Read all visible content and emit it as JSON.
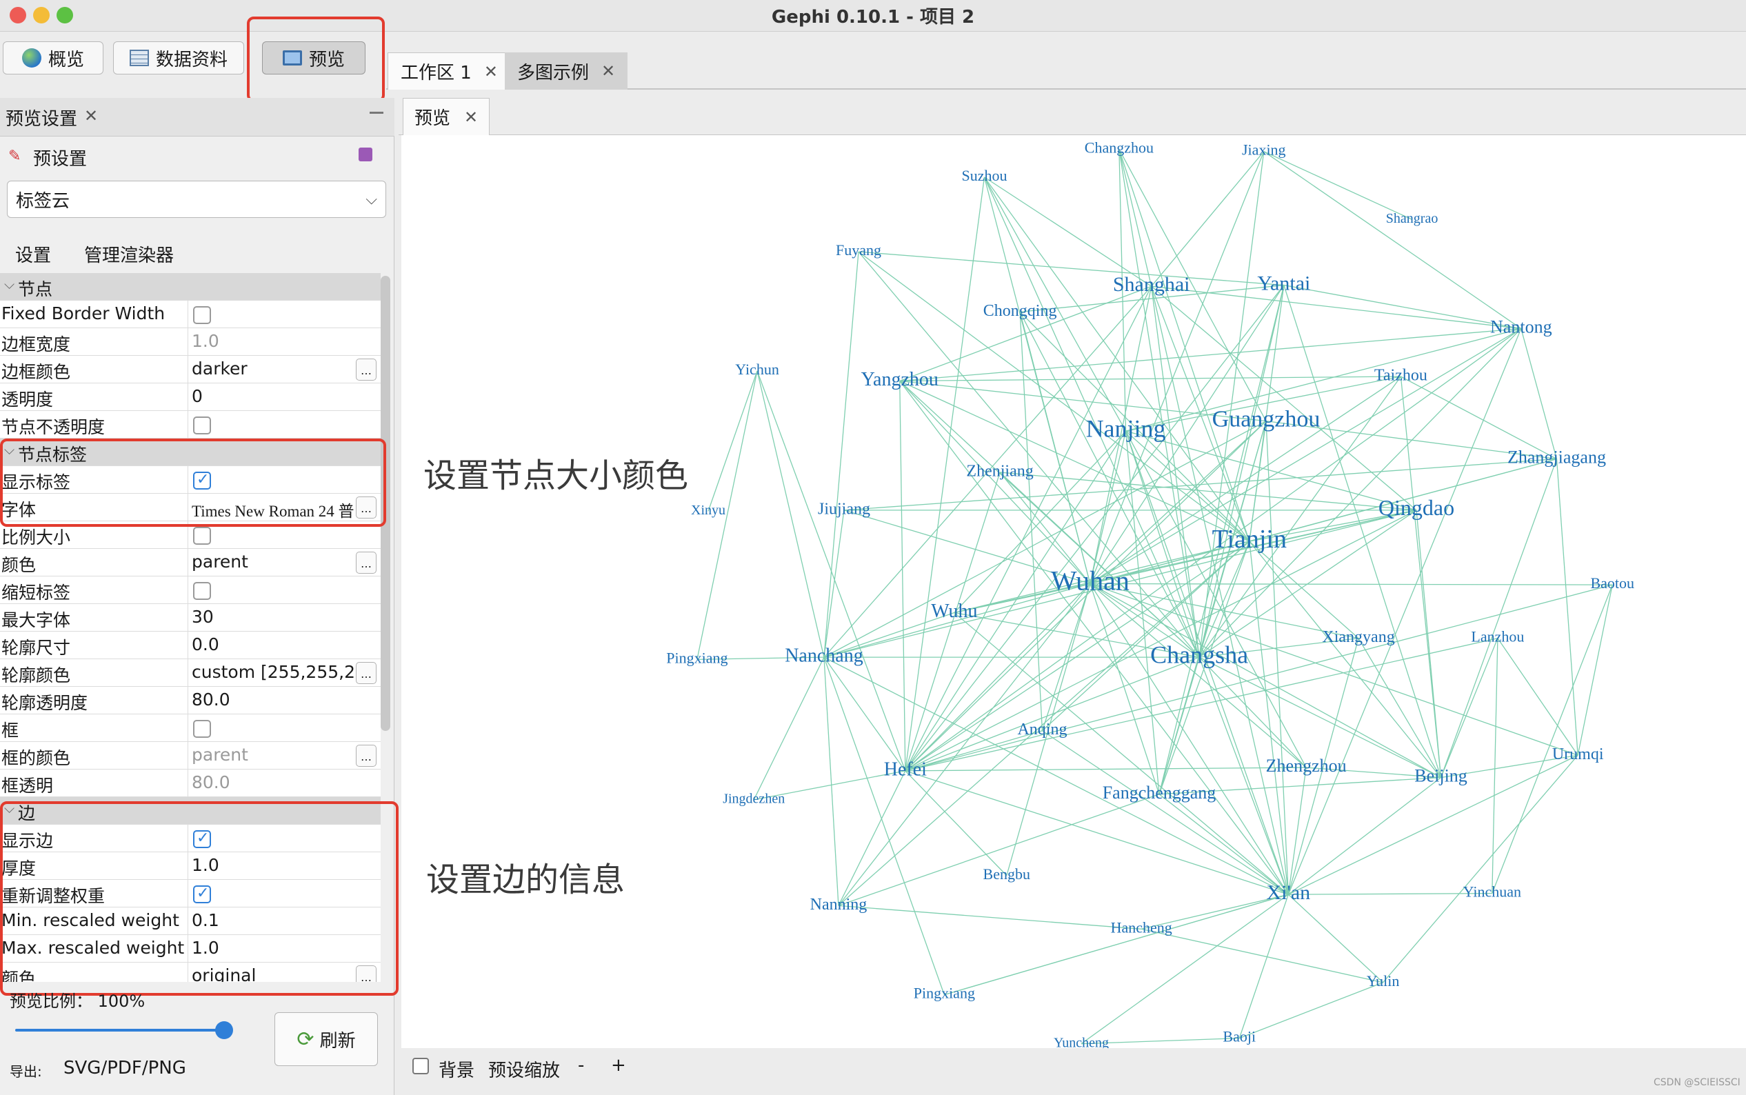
{
  "window": {
    "title": "Gephi 0.10.1 - 项目 2"
  },
  "modes": [
    {
      "label": "概览",
      "icon": "globe-icon"
    },
    {
      "label": "数据资料",
      "icon": "table-icon"
    },
    {
      "label": "预览",
      "icon": "monitor-icon",
      "active": true
    }
  ],
  "workspace_tabs": [
    {
      "label": "工作区 1",
      "active": true
    },
    {
      "label": "多图示例",
      "active": false
    }
  ],
  "left": {
    "panel_title": "预览设置",
    "preset_label": "预设置",
    "preset_value": "标签云",
    "subtabs": [
      "设置",
      "管理渲染器"
    ],
    "properties": [
      {
        "type": "group",
        "name": "节点"
      },
      {
        "name": "Fixed Border Width",
        "kind": "checkbox",
        "checked": false
      },
      {
        "name": "边框宽度",
        "kind": "text",
        "value": "1.0",
        "disabled": true
      },
      {
        "name": "边框颜色",
        "kind": "text",
        "value": "darker",
        "dots": true
      },
      {
        "name": "透明度",
        "kind": "text",
        "value": "0"
      },
      {
        "name": "节点不透明度",
        "kind": "checkbox",
        "checked": false
      },
      {
        "type": "group",
        "name": "节点标签"
      },
      {
        "name": "显示标签",
        "kind": "checkbox",
        "checked": true
      },
      {
        "name": "字体",
        "kind": "font",
        "value": "Times New Roman 24 普",
        "dots": true
      },
      {
        "name": "比例大小",
        "kind": "checkbox",
        "checked": false
      },
      {
        "name": "颜色",
        "kind": "text",
        "value": "parent",
        "dots": true
      },
      {
        "name": "缩短标签",
        "kind": "checkbox",
        "checked": false
      },
      {
        "name": "最大字体",
        "kind": "text",
        "value": "30"
      },
      {
        "name": "轮廓尺寸",
        "kind": "text",
        "value": "0.0"
      },
      {
        "name": "轮廓颜色",
        "kind": "text",
        "value": "custom [255,255,2...",
        "dots": true
      },
      {
        "name": "轮廓透明度",
        "kind": "text",
        "value": "80.0"
      },
      {
        "name": "框",
        "kind": "checkbox",
        "checked": false
      },
      {
        "name": "框的颜色",
        "kind": "text",
        "value": "parent",
        "disabled": true,
        "dots": true
      },
      {
        "name": "框透明",
        "kind": "text",
        "value": "80.0",
        "disabled": true
      },
      {
        "type": "group",
        "name": "边"
      },
      {
        "name": "显示边",
        "kind": "checkbox",
        "checked": true
      },
      {
        "name": "厚度",
        "kind": "text",
        "value": "1.0"
      },
      {
        "name": "重新调整权重",
        "kind": "checkbox",
        "checked": true
      },
      {
        "name": "Min. rescaled weight",
        "kind": "text",
        "value": "0.1"
      },
      {
        "name": "Max. rescaled weight",
        "kind": "text",
        "value": "1.0"
      },
      {
        "name": "颜色",
        "kind": "text",
        "value": "original",
        "dots": true
      }
    ],
    "zoom_label": "预览比例： 100%",
    "zoom_value": 1.0,
    "refresh_label": "刷新",
    "export_label": "导出:",
    "export_value": "SVG/PDF/PNG"
  },
  "preview": {
    "tab_label": "预览",
    "annotation_nodes": "设置节点大小颜色",
    "annotation_edges": "设置边的信息",
    "bottom": {
      "background_label": "背景",
      "zoom_label": "预设缩放",
      "minus": "-",
      "plus": "+"
    },
    "edge_color": "#7fcfb0",
    "label_color": "#1f6fb5",
    "watermark": "CSDN @SCIEISSCI"
  },
  "graph": {
    "nodes": [
      {
        "id": "Changzhou",
        "label": "Changzhou",
        "size": 22
      },
      {
        "id": "Jiaxing",
        "label": "Jiaxing",
        "size": 22
      },
      {
        "id": "Suzhou",
        "label": "Suzhou",
        "size": 22
      },
      {
        "id": "Shangrao",
        "label": "Shangrao",
        "size": 20
      },
      {
        "id": "Fuyang",
        "label": "Fuyang",
        "size": 22
      },
      {
        "id": "Shanghai",
        "label": "Shanghai",
        "size": 30
      },
      {
        "id": "Yantai",
        "label": "Yantai",
        "size": 30
      },
      {
        "id": "Chongqing",
        "label": "Chongqing",
        "size": 24
      },
      {
        "id": "Nantong",
        "label": "Nantong",
        "size": 26
      },
      {
        "id": "Yichun",
        "label": "Yichun",
        "size": 22
      },
      {
        "id": "Yangzhou",
        "label": "Yangzhou",
        "size": 28
      },
      {
        "id": "Taizhou",
        "label": "Taizhou",
        "size": 24
      },
      {
        "id": "Nanjing",
        "label": "Nanjing",
        "size": 36
      },
      {
        "id": "Guangzhou",
        "label": "Guangzhou",
        "size": 34
      },
      {
        "id": "Zhangjiagang",
        "label": "Zhangjiagang",
        "size": 26
      },
      {
        "id": "Zhenjiang",
        "label": "Zhenjiang",
        "size": 24
      },
      {
        "id": "Xinyu",
        "label": "Xinyu",
        "size": 20
      },
      {
        "id": "Jiujiang",
        "label": "Jiujiang",
        "size": 24
      },
      {
        "id": "Qingdao",
        "label": "Qingdao",
        "size": 32
      },
      {
        "id": "Tianjin",
        "label": "Tianjin",
        "size": 38
      },
      {
        "id": "Baotou",
        "label": "Baotou",
        "size": 22
      },
      {
        "id": "Wuhan",
        "label": "Wuhan",
        "size": 40
      },
      {
        "id": "Wuhu",
        "label": "Wuhu",
        "size": 28
      },
      {
        "id": "Changsha",
        "label": "Changsha",
        "size": 36
      },
      {
        "id": "Xiangyang",
        "label": "Xiangyang",
        "size": 24
      },
      {
        "id": "Lanzhou",
        "label": "Lanzhou",
        "size": 22
      },
      {
        "id": "Pingxiang1",
        "label": "Pingxiang",
        "size": 22
      },
      {
        "id": "Nanchang",
        "label": "Nanchang",
        "size": 28
      },
      {
        "id": "Anqing",
        "label": "Anqing",
        "size": 24
      },
      {
        "id": "Urumqi",
        "label": "Urumqi",
        "size": 24
      },
      {
        "id": "Hefei",
        "label": "Hefei",
        "size": 28
      },
      {
        "id": "Zhengzhou",
        "label": "Zhengzhou",
        "size": 26
      },
      {
        "id": "Beijing",
        "label": "Beijing",
        "size": 26
      },
      {
        "id": "Jingdezhen",
        "label": "Jingdezhen",
        "size": 20
      },
      {
        "id": "Fangchenggang",
        "label": "Fangchenggang",
        "size": 26
      },
      {
        "id": "Bengbu",
        "label": "Bengbu",
        "size": 22
      },
      {
        "id": "Xian",
        "label": "Xi'an",
        "size": 30
      },
      {
        "id": "Yinchuan",
        "label": "Yinchuan",
        "size": 22
      },
      {
        "id": "Nanning",
        "label": "Nanning",
        "size": 24
      },
      {
        "id": "Hancheng",
        "label": "Hancheng",
        "size": 22
      },
      {
        "id": "Pingxiang2",
        "label": "Pingxiang",
        "size": 22
      },
      {
        "id": "Yulin",
        "label": "Yulin",
        "size": 22
      },
      {
        "id": "Yuncheng",
        "label": "Yuncheng",
        "size": 20
      },
      {
        "id": "Baoji",
        "label": "Baoji",
        "size": 22
      }
    ],
    "edges": [
      [
        "Suzhou",
        "Shanghai"
      ],
      [
        "Suzhou",
        "Nanjing"
      ],
      [
        "Suzhou",
        "Tianjin"
      ],
      [
        "Suzhou",
        "Wuhan"
      ],
      [
        "Suzhou",
        "Hefei"
      ],
      [
        "Suzhou",
        "Changsha"
      ],
      [
        "Changzhou",
        "Shanghai"
      ],
      [
        "Changzhou",
        "Nanjing"
      ],
      [
        "Changzhou",
        "Tianjin"
      ],
      [
        "Changzhou",
        "Changsha"
      ],
      [
        "Changzhou",
        "Guangzhou"
      ],
      [
        "Jiaxing",
        "Shanghai"
      ],
      [
        "Jiaxing",
        "Nantong"
      ],
      [
        "Jiaxing",
        "Shangrao"
      ],
      [
        "Jiaxing",
        "Wuhan"
      ],
      [
        "Jiaxing",
        "Changsha"
      ],
      [
        "Fuyang",
        "Yantai"
      ],
      [
        "Fuyang",
        "Nanchang"
      ],
      [
        "Fuyang",
        "Tianjin"
      ],
      [
        "Fuyang",
        "Changsha"
      ],
      [
        "Shanghai",
        "Wuhan"
      ],
      [
        "Shanghai",
        "Tianjin"
      ],
      [
        "Shanghai",
        "Changsha"
      ],
      [
        "Shanghai",
        "Qingdao"
      ],
      [
        "Shanghai",
        "Hefei"
      ],
      [
        "Shanghai",
        "Nanchang"
      ],
      [
        "Shanghai",
        "Xian"
      ],
      [
        "Shanghai",
        "Nantong"
      ],
      [
        "Shanghai",
        "Yangzhou"
      ],
      [
        "Yantai",
        "Wuhan"
      ],
      [
        "Yantai",
        "Tianjin"
      ],
      [
        "Yantai",
        "Changsha"
      ],
      [
        "Yantai",
        "Nantong"
      ],
      [
        "Yantai",
        "Beijing"
      ],
      [
        "Yantai",
        "Hefei"
      ],
      [
        "Yantai",
        "Chongqing"
      ],
      [
        "Yantai",
        "Fangchenggang"
      ],
      [
        "Chongqing",
        "Wuhan"
      ],
      [
        "Chongqing",
        "Tianjin"
      ],
      [
        "Chongqing",
        "Changsha"
      ],
      [
        "Chongqing",
        "Anqing"
      ],
      [
        "Nantong",
        "Wuhan"
      ],
      [
        "Nantong",
        "Changsha"
      ],
      [
        "Nantong",
        "Zhangjiagang"
      ],
      [
        "Nantong",
        "Xian"
      ],
      [
        "Nantong",
        "Yangzhou"
      ],
      [
        "Nantong",
        "Hefei"
      ],
      [
        "Nantong",
        "Nanjing"
      ],
      [
        "Yichun",
        "Xinyu"
      ],
      [
        "Yichun",
        "Nanchang"
      ],
      [
        "Yichun",
        "Pingxiang1"
      ],
      [
        "Yichun",
        "Hefei"
      ],
      [
        "Yangzhou",
        "Wuhan"
      ],
      [
        "Yangzhou",
        "Tianjin"
      ],
      [
        "Yangzhou",
        "Guangzhou"
      ],
      [
        "Yangzhou",
        "Hefei"
      ],
      [
        "Yangzhou",
        "Xian"
      ],
      [
        "Yangzhou",
        "Changsha"
      ],
      [
        "Yangzhou",
        "Taizhou"
      ],
      [
        "Taizhou",
        "Wuhan"
      ],
      [
        "Taizhou",
        "Changsha"
      ],
      [
        "Taizhou",
        "Zhangjiagang"
      ],
      [
        "Taizhou",
        "Nanjing"
      ],
      [
        "Taizhou",
        "Beijing"
      ],
      [
        "Nanjing",
        "Wuhan"
      ],
      [
        "Nanjing",
        "Tianjin"
      ],
      [
        "Nanjing",
        "Changsha"
      ],
      [
        "Nanjing",
        "Hefei"
      ],
      [
        "Nanjing",
        "Qingdao"
      ],
      [
        "Nanjing",
        "Xian"
      ],
      [
        "Nanjing",
        "Fangchenggang"
      ],
      [
        "Nanjing",
        "Wuhu"
      ],
      [
        "Nanjing",
        "Zhengzhou"
      ],
      [
        "Guangzhou",
        "Wuhan"
      ],
      [
        "Guangzhou",
        "Tianjin"
      ],
      [
        "Guangzhou",
        "Changsha"
      ],
      [
        "Guangzhou",
        "Zhangjiagang"
      ],
      [
        "Guangzhou",
        "Hefei"
      ],
      [
        "Guangzhou",
        "Fangchenggang"
      ],
      [
        "Guangzhou",
        "Nanchang"
      ],
      [
        "Guangzhou",
        "Xian"
      ],
      [
        "Zhangjiagang",
        "Wuhan"
      ],
      [
        "Zhangjiagang",
        "Tianjin"
      ],
      [
        "Zhangjiagang",
        "Beijing"
      ],
      [
        "Zhangjiagang",
        "Urumqi"
      ],
      [
        "Zhangjiagang",
        "Jiujiang"
      ],
      [
        "Zhenjiang",
        "Wuhan"
      ],
      [
        "Zhenjiang",
        "Qingdao"
      ],
      [
        "Zhenjiang",
        "Changsha"
      ],
      [
        "Zhenjiang",
        "Hefei"
      ],
      [
        "Jiujiang",
        "Wuhan"
      ],
      [
        "Jiujiang",
        "Qingdao"
      ],
      [
        "Jiujiang",
        "Nanchang"
      ],
      [
        "Qingdao",
        "Wuhan"
      ],
      [
        "Qingdao",
        "Tianjin"
      ],
      [
        "Qingdao",
        "Changsha"
      ],
      [
        "Qingdao",
        "Beijing"
      ],
      [
        "Qingdao",
        "Hefei"
      ],
      [
        "Qingdao",
        "Wuhu"
      ],
      [
        "Qingdao",
        "Nanchang"
      ],
      [
        "Tianjin",
        "Wuhan"
      ],
      [
        "Tianjin",
        "Changsha"
      ],
      [
        "Tianjin",
        "Xian"
      ],
      [
        "Tianjin",
        "Beijing"
      ],
      [
        "Tianjin",
        "Fangchenggang"
      ],
      [
        "Tianjin",
        "Hefei"
      ],
      [
        "Tianjin",
        "Wuhu"
      ],
      [
        "Tianjin",
        "Anqing"
      ],
      [
        "Tianjin",
        "Nanning"
      ],
      [
        "Tianjin",
        "Xiangyang"
      ],
      [
        "Baotou",
        "Hefei"
      ],
      [
        "Baotou",
        "Urumqi"
      ],
      [
        "Baotou",
        "Yinchuan"
      ],
      [
        "Baotou",
        "Wuhan"
      ],
      [
        "Wuhan",
        "Changsha"
      ],
      [
        "Wuhan",
        "Hefei"
      ],
      [
        "Wuhan",
        "Xian"
      ],
      [
        "Wuhan",
        "Zhengzhou"
      ],
      [
        "Wuhan",
        "Nanchang"
      ],
      [
        "Wuhan",
        "Fangchenggang"
      ],
      [
        "Wuhan",
        "Bengbu"
      ],
      [
        "Wuhan",
        "Anqing"
      ],
      [
        "Wuhan",
        "Nanning"
      ],
      [
        "Wuhan",
        "Xiangyang"
      ],
      [
        "Wuhan",
        "Beijing"
      ],
      [
        "Wuhan",
        "Wuhu"
      ],
      [
        "Wuhan",
        "Urumqi"
      ],
      [
        "Wuhu",
        "Changsha"
      ],
      [
        "Wuhu",
        "Nanchang"
      ],
      [
        "Wuhu",
        "Xian"
      ],
      [
        "Changsha",
        "Xian"
      ],
      [
        "Changsha",
        "Fangchenggang"
      ],
      [
        "Changsha",
        "Nanchang"
      ],
      [
        "Changsha",
        "Beijing"
      ],
      [
        "Changsha",
        "Hefei"
      ],
      [
        "Changsha",
        "Xiangyang"
      ],
      [
        "Changsha",
        "Zhengzhou"
      ],
      [
        "Xiangyang",
        "Beijing"
      ],
      [
        "Xiangyang",
        "Xian"
      ],
      [
        "Lanzhou",
        "Yinchuan"
      ],
      [
        "Lanzhou",
        "Beijing"
      ],
      [
        "Lanzhou",
        "Urumqi"
      ],
      [
        "Lanzhou",
        "Hefei"
      ],
      [
        "Pingxiang1",
        "Nanchang"
      ],
      [
        "Nanchang",
        "Hefei"
      ],
      [
        "Nanchang",
        "Jingdezhen"
      ],
      [
        "Nanchang",
        "Nanning"
      ],
      [
        "Nanchang",
        "Xian"
      ],
      [
        "Nanchang",
        "Pingxiang2"
      ],
      [
        "Anqing",
        "Hefei"
      ],
      [
        "Anqing",
        "Xian"
      ],
      [
        "Urumqi",
        "Beijing"
      ],
      [
        "Urumqi",
        "Xian"
      ],
      [
        "Urumqi",
        "Yulin"
      ],
      [
        "Hefei",
        "Xian"
      ],
      [
        "Hefei",
        "Bengbu"
      ],
      [
        "Hefei",
        "Nanning"
      ],
      [
        "Hefei",
        "Jingdezhen"
      ],
      [
        "Hefei",
        "Zhengzhou"
      ],
      [
        "Zhengzhou",
        "Beijing"
      ],
      [
        "Zhengzhou",
        "Xian"
      ],
      [
        "Beijing",
        "Xian"
      ],
      [
        "Beijing",
        "Fangchenggang"
      ],
      [
        "Fangchenggang",
        "Nanning"
      ],
      [
        "Fangchenggang",
        "Xian"
      ],
      [
        "Xian",
        "Yinchuan"
      ],
      [
        "Xian",
        "Hancheng"
      ],
      [
        "Xian",
        "Yulin"
      ],
      [
        "Xian",
        "Baoji"
      ],
      [
        "Xian",
        "Yuncheng"
      ],
      [
        "Xian",
        "Pingxiang2"
      ],
      [
        "Hancheng",
        "Yulin"
      ],
      [
        "Hancheng",
        "Nanning"
      ],
      [
        "Yulin",
        "Baoji"
      ],
      [
        "Yuncheng",
        "Baoji"
      ],
      [
        "Pingxiang2",
        "Xian"
      ]
    ]
  }
}
